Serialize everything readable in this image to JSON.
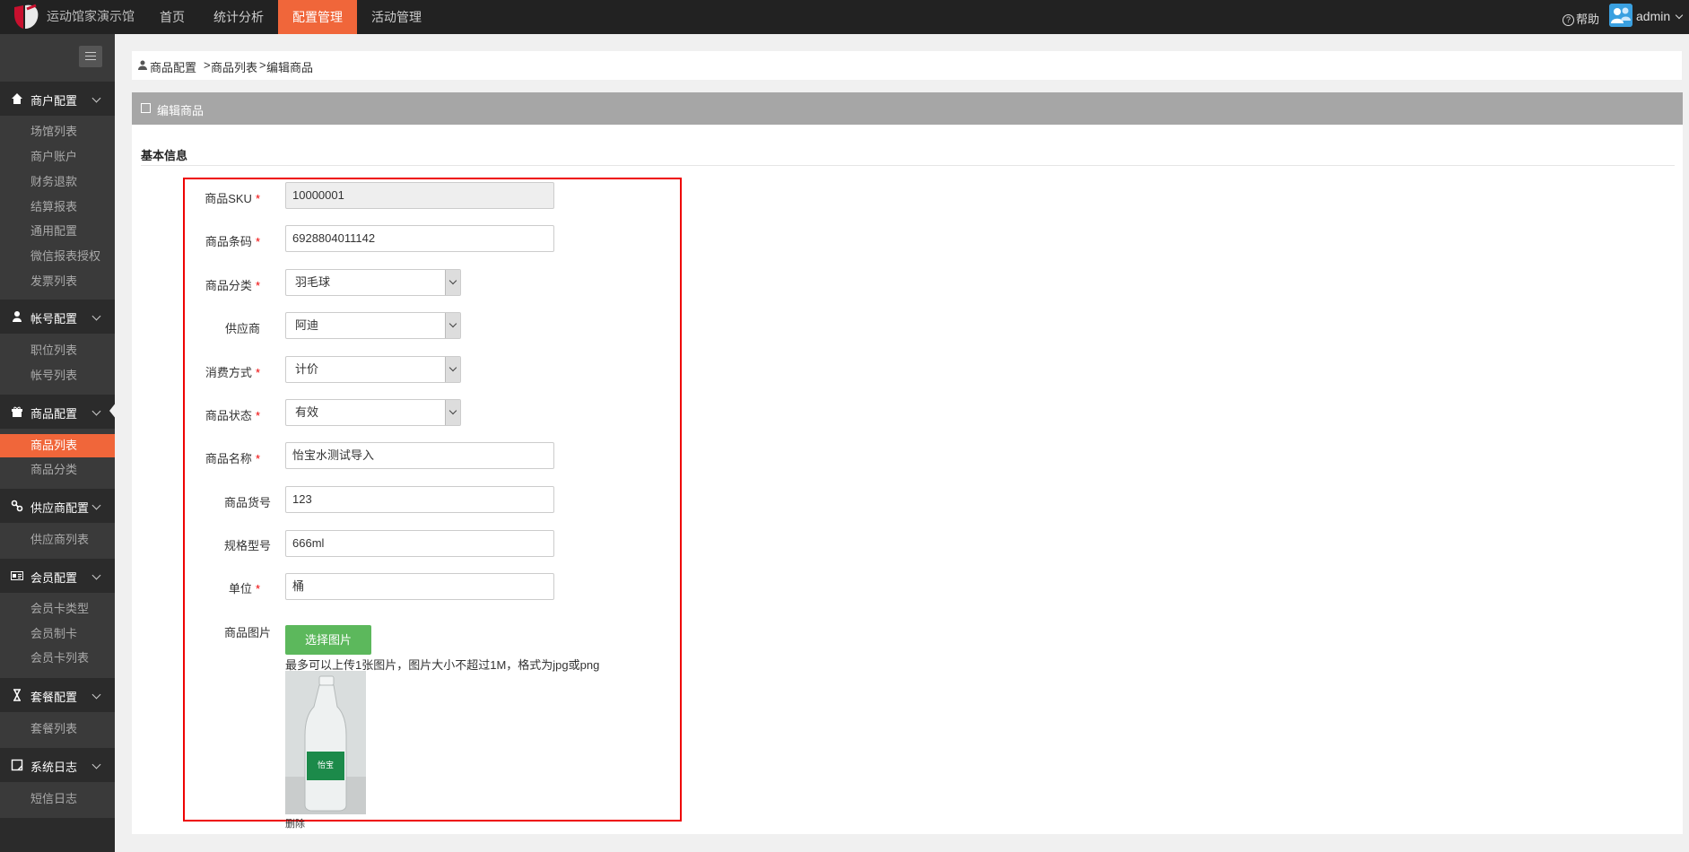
{
  "app": {
    "title": "运动馆家演示馆",
    "user": "admin",
    "help": "帮助"
  },
  "nav": [
    "首页",
    "统计分析",
    "配置管理",
    "活动管理"
  ],
  "sidebar": [
    {
      "title": "商户配置",
      "items": [
        "场馆列表",
        "商户账户",
        "财务退款",
        "结算报表",
        "通用配置",
        "微信报表授权",
        "发票列表"
      ]
    },
    {
      "title": "帐号配置",
      "items": [
        "职位列表",
        "帐号列表"
      ]
    },
    {
      "title": "商品配置",
      "items": [
        "商品列表",
        "商品分类"
      ],
      "active_item": "商品列表"
    },
    {
      "title": "供应商配置",
      "items": [
        "供应商列表"
      ]
    },
    {
      "title": "会员配置",
      "items": [
        "会员卡类型",
        "会员制卡",
        "会员卡列表"
      ]
    },
    {
      "title": "套餐配置",
      "items": [
        "套餐列表"
      ]
    },
    {
      "title": "系统日志",
      "items": [
        "短信日志"
      ]
    }
  ],
  "breadcrumb": [
    "商品配置",
    ">",
    "商品列表",
    ">",
    "编辑商品"
  ],
  "panel": {
    "title": "编辑商品",
    "section": "基本信息"
  },
  "form": {
    "sku": {
      "label": "商品SKU",
      "value": "10000001"
    },
    "barcode": {
      "label": "商品条码",
      "value": "6928804011142"
    },
    "category": {
      "label": "商品分类",
      "value": "羽毛球"
    },
    "supplier": {
      "label": "供应商",
      "value": "阿迪"
    },
    "consume": {
      "label": "消费方式",
      "value": "计价"
    },
    "status": {
      "label": "商品状态",
      "value": "有效"
    },
    "name": {
      "label": "商品名称",
      "value": "怡宝水测试导入"
    },
    "code": {
      "label": "商品货号",
      "value": "123"
    },
    "spec": {
      "label": "规格型号",
      "value": "666ml"
    },
    "unit": {
      "label": "单位",
      "value": "桶"
    },
    "image": {
      "label": "商品图片",
      "button": "选择图片",
      "hint": "最多可以上传1张图片，图片大小不超过1M，格式为jpg或png",
      "delete": "删除",
      "bottle_label": "怡宝"
    }
  },
  "required_mark": "*",
  "colors": {
    "accent": "#f0663a",
    "green": "#5cb85c",
    "danger": "#e00000"
  }
}
